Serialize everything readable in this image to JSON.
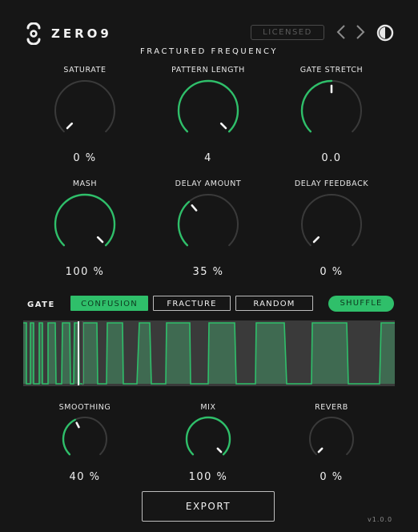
{
  "header": {
    "brand_name": "ZERO9",
    "license_label": "LICENSED",
    "icons": [
      "zero9-logo-icon",
      "chevron-left-icon",
      "chevron-right-icon",
      "contrast-toggle-icon"
    ]
  },
  "subtitle": "FRACTURED FREQUENCY",
  "colors": {
    "accent": "#2fbf6a",
    "background": "#161616",
    "track": "#3a3a3a"
  },
  "knobs_top": [
    {
      "key": "saturate",
      "label": "SATURATE",
      "value": "0 %",
      "level": 0.0
    },
    {
      "key": "pattern-length",
      "label": "PATTERN LENGTH",
      "value": "4",
      "level": 1.0
    },
    {
      "key": "gate-stretch",
      "label": "GATE STRETCH",
      "value": "0.0",
      "level": 0.5
    },
    {
      "key": "mash",
      "label": "MASH",
      "value": "100 %",
      "level": 1.0
    },
    {
      "key": "delay-amount",
      "label": "DELAY AMOUNT",
      "value": "35 %",
      "level": 0.35
    },
    {
      "key": "delay-feedback",
      "label": "DELAY FEEDBACK",
      "value": "0 %",
      "level": 0.0
    }
  ],
  "gate": {
    "label": "GATE",
    "modes": [
      "CONFUSION",
      "FRACTURE",
      "RANDOM"
    ],
    "selected_mode": "CONFUSION",
    "shuffle_label": "SHUFFLE"
  },
  "knobs_bottom": [
    {
      "key": "smoothing",
      "label": "SMOOTHING",
      "value": "40 %",
      "level": 0.4
    },
    {
      "key": "mix",
      "label": "MIX",
      "value": "100 %",
      "level": 1.0
    },
    {
      "key": "reverb",
      "label": "REVERB",
      "value": "0 %",
      "level": 0.0
    }
  ],
  "export_label": "EXPORT",
  "version": "v1.0.0"
}
